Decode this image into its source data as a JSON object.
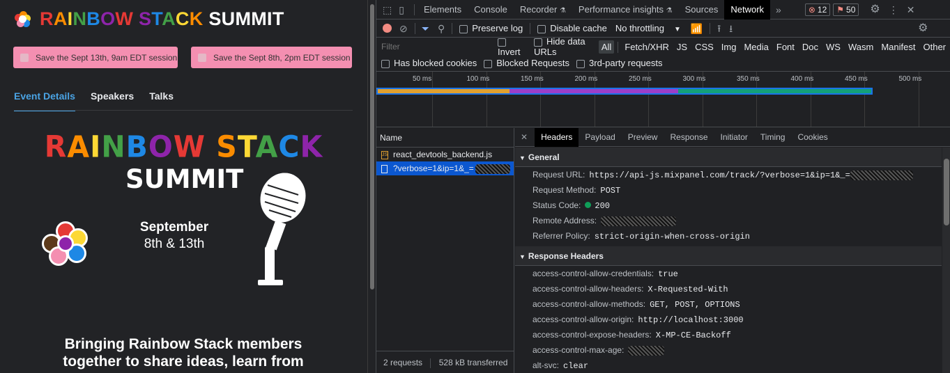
{
  "site": {
    "title_parts": [
      "RAINBOW ",
      "STACK ",
      "SUMMIT"
    ],
    "title_colors": {
      "rainbow": [
        "#e53935",
        "#fb8c00",
        "#fdd835",
        "#43a047",
        "#1e88e5",
        "#8e24aa"
      ],
      "summit": "#ffffff"
    },
    "buttons": [
      "Save the Sept 13th, 9am EDT session",
      "Save the Sept 8th, 2pm EDT session"
    ],
    "tabs": [
      "Event Details",
      "Speakers",
      "Talks"
    ],
    "hero": {
      "line1": "RAINBOW STACK",
      "line2": "SUMMIT",
      "date_month": "September",
      "date_days": "8th & 13th"
    },
    "tagline_line1": "Bringing Rainbow Stack members",
    "tagline_line2": "together to share ideas, learn from"
  },
  "devtools": {
    "tabs": [
      "Elements",
      "Console",
      "Recorder",
      "Performance insights",
      "Sources",
      "Network"
    ],
    "active_tab": "Network",
    "errors_count": "12",
    "warnings_count": "50",
    "toolbar": {
      "preserve_log": "Preserve log",
      "disable_cache": "Disable cache",
      "throttling": "No throttling"
    },
    "filter": {
      "placeholder": "Filter",
      "invert": "Invert",
      "hide_data_urls": "Hide data URLs",
      "types": [
        "All",
        "Fetch/XHR",
        "JS",
        "CSS",
        "Img",
        "Media",
        "Font",
        "Doc",
        "WS",
        "Wasm",
        "Manifest",
        "Other"
      ],
      "selected_type": "All",
      "has_blocked_cookies": "Has blocked cookies",
      "blocked_requests": "Blocked Requests",
      "third_party": "3rd-party requests"
    },
    "timeline_ticks": [
      "50 ms",
      "100 ms",
      "150 ms",
      "200 ms",
      "250 ms",
      "300 ms",
      "350 ms",
      "400 ms",
      "450 ms",
      "500 ms"
    ],
    "timeline_colors": {
      "waiting": "#e0a030",
      "content": "#9c3fc8",
      "download": "#13a07a",
      "outline": "#1a73e8"
    },
    "requests": {
      "header": "Name",
      "items": [
        "react_devtools_backend.js",
        "?verbose=1&ip=1&_="
      ],
      "summary_count": "2 requests",
      "summary_transfer": "528 kB transferred"
    },
    "detail_tabs": [
      "Headers",
      "Payload",
      "Preview",
      "Response",
      "Initiator",
      "Timing",
      "Cookies"
    ],
    "active_detail_tab": "Headers",
    "general": {
      "title": "General",
      "rows": [
        {
          "k": "Request URL:",
          "v": "https://api-js.mixpanel.com/track/?verbose=1&ip=1&_="
        },
        {
          "k": "Request Method:",
          "v": "POST"
        },
        {
          "k": "Status Code:",
          "v": "200"
        },
        {
          "k": "Remote Address:",
          "v": ""
        },
        {
          "k": "Referrer Policy:",
          "v": "strict-origin-when-cross-origin"
        }
      ]
    },
    "response_headers": {
      "title": "Response Headers",
      "rows": [
        {
          "k": "access-control-allow-credentials:",
          "v": "true"
        },
        {
          "k": "access-control-allow-headers:",
          "v": "X-Requested-With"
        },
        {
          "k": "access-control-allow-methods:",
          "v": "GET, POST, OPTIONS"
        },
        {
          "k": "access-control-allow-origin:",
          "v": "http://localhost:3000"
        },
        {
          "k": "access-control-expose-headers:",
          "v": "X-MP-CE-Backoff"
        },
        {
          "k": "access-control-max-age:",
          "v": ""
        },
        {
          "k": "alt-svc:",
          "v": "clear"
        }
      ]
    }
  }
}
